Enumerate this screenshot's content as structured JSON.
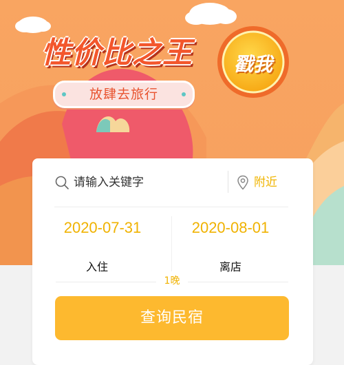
{
  "banner": {
    "title": "性价比之王",
    "subtitle": "放肆去旅行",
    "coin_label": "戳我"
  },
  "search": {
    "placeholder": "请输入关键字",
    "nearby_label": "附近"
  },
  "dates": {
    "checkin_date": "2020-07-31",
    "checkout_date": "2020-08-01",
    "checkin_label": "入住",
    "checkout_label": "离店",
    "nights": "1晚"
  },
  "actions": {
    "query_label": "查询民宿"
  },
  "colors": {
    "accent": "#f0b200",
    "button": "#fdb92f",
    "banner_bg": "#f7a15f",
    "title": "#f3562c"
  }
}
